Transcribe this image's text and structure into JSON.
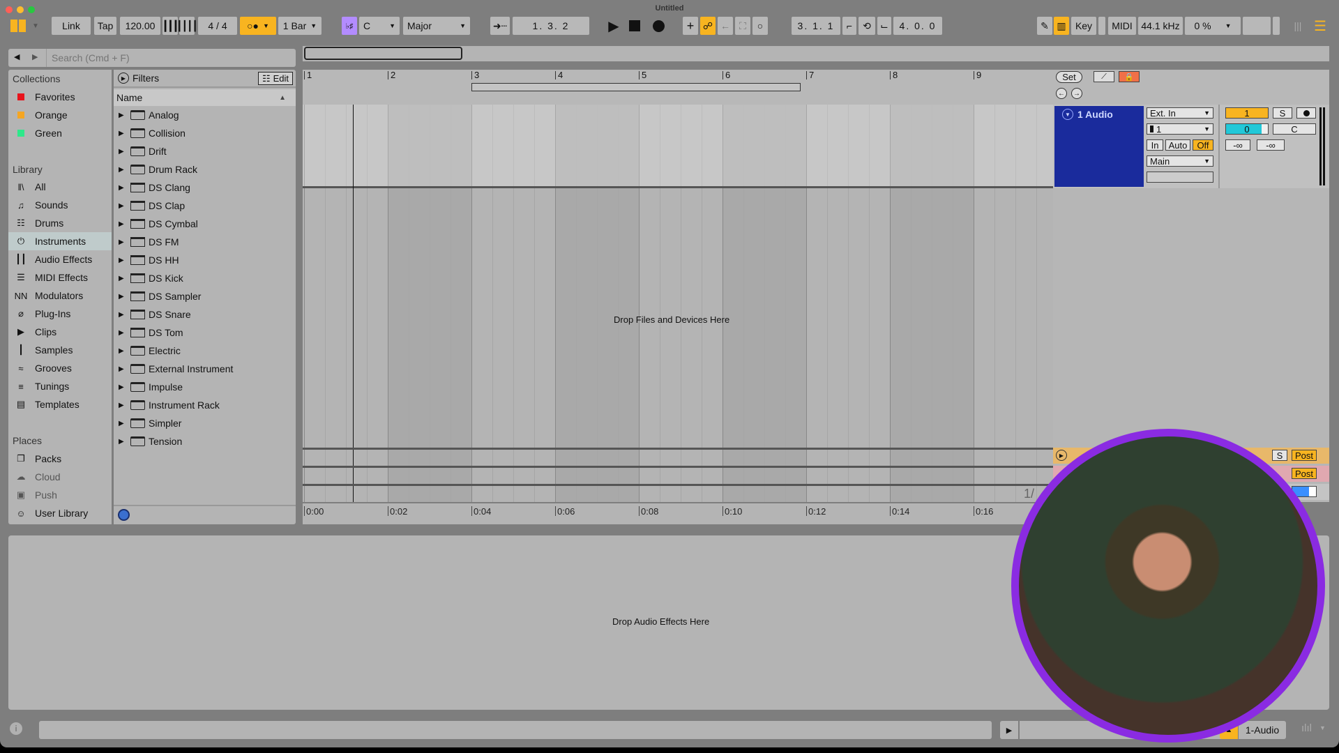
{
  "window": {
    "title": "Untitled"
  },
  "toolbar": {
    "link": "Link",
    "tap": "Tap",
    "tempo": "120.00",
    "time_signature": "4 / 4",
    "metronome_icon": "metronome-icon",
    "quantize": "1 Bar",
    "scale_root": "C",
    "scale_mode": "Major",
    "arrangement_position": "1.  3.  2",
    "loop_start": "3.  1.  1",
    "loop_length": "4.  0.  0",
    "key": "Key",
    "midi": "MIDI",
    "sample_rate": "44.1 kHz",
    "cpu": "0 %"
  },
  "browser": {
    "search_placeholder": "Search (Cmd + F)",
    "collections_title": "Collections",
    "collections": [
      {
        "label": "Favorites",
        "color": "#e8141c"
      },
      {
        "label": "Orange",
        "color": "#f5a623"
      },
      {
        "label": "Green",
        "color": "#2ee88a"
      }
    ],
    "library_title": "Library",
    "library": [
      {
        "label": "All",
        "icon": "all-icon",
        "glyph": "‖\\"
      },
      {
        "label": "Sounds",
        "icon": "sounds-icon",
        "glyph": "♫"
      },
      {
        "label": "Drums",
        "icon": "drums-icon",
        "glyph": "☷"
      },
      {
        "label": "Instruments",
        "icon": "instruments-icon",
        "glyph": "⏻",
        "selected": true
      },
      {
        "label": "Audio Effects",
        "icon": "audio-effects-icon",
        "glyph": "┃┃"
      },
      {
        "label": "MIDI Effects",
        "icon": "midi-effects-icon",
        "glyph": "☰"
      },
      {
        "label": "Modulators",
        "icon": "modulators-icon",
        "glyph": "NN"
      },
      {
        "label": "Plug-Ins",
        "icon": "plugins-icon",
        "glyph": "⌀"
      },
      {
        "label": "Clips",
        "icon": "clips-icon",
        "glyph": "▶"
      },
      {
        "label": "Samples",
        "icon": "samples-icon",
        "glyph": "┃"
      },
      {
        "label": "Grooves",
        "icon": "grooves-icon",
        "glyph": "≈"
      },
      {
        "label": "Tunings",
        "icon": "tunings-icon",
        "glyph": "≡"
      },
      {
        "label": "Templates",
        "icon": "templates-icon",
        "glyph": "▤"
      }
    ],
    "places_title": "Places",
    "places": [
      {
        "label": "Packs",
        "icon": "packs-icon",
        "glyph": "❐"
      },
      {
        "label": "Cloud",
        "icon": "cloud-icon",
        "glyph": "☁"
      },
      {
        "label": "Push",
        "icon": "push-icon",
        "glyph": "▣"
      },
      {
        "label": "User Library",
        "icon": "user-library-icon",
        "glyph": "☺"
      }
    ],
    "filters_label": "Filters",
    "edit_label": "Edit",
    "column_name": "Name",
    "items": [
      {
        "label": "Analog",
        "ds": false
      },
      {
        "label": "Collision",
        "ds": false
      },
      {
        "label": "Drift",
        "ds": false
      },
      {
        "label": "Drum Rack",
        "ds": false
      },
      {
        "label": "DS Clang",
        "ds": true
      },
      {
        "label": "DS Clap",
        "ds": true
      },
      {
        "label": "DS Cymbal",
        "ds": true
      },
      {
        "label": "DS FM",
        "ds": true
      },
      {
        "label": "DS HH",
        "ds": true
      },
      {
        "label": "DS Kick",
        "ds": true
      },
      {
        "label": "DS Sampler",
        "ds": true
      },
      {
        "label": "DS Snare",
        "ds": true
      },
      {
        "label": "DS Tom",
        "ds": true
      },
      {
        "label": "Electric",
        "ds": false
      },
      {
        "label": "External Instrument",
        "ds": false
      },
      {
        "label": "Impulse",
        "ds": false
      },
      {
        "label": "Instrument Rack",
        "ds": false
      },
      {
        "label": "Simpler",
        "ds": false
      },
      {
        "label": "Tension",
        "ds": false
      }
    ]
  },
  "arrangement": {
    "bars": [
      "1",
      "2",
      "3",
      "4",
      "5",
      "6",
      "7",
      "8",
      "9"
    ],
    "time_ticks": [
      "0:00",
      "0:02",
      "0:04",
      "0:06",
      "0:08",
      "0:10",
      "0:12",
      "0:14",
      "0:16"
    ],
    "drop_files_text": "Drop Files and Devices Here",
    "partial_label": "1/",
    "set_label": "Set"
  },
  "track": {
    "name": "1 Audio",
    "input_type": "Ext. In",
    "input_channel": "1",
    "monitor_in": "In",
    "monitor_auto": "Auto",
    "monitor_off": "Off",
    "output": "Main",
    "track_number": "1",
    "solo": "S",
    "volume": "0",
    "pan": "C",
    "send_a": "-∞",
    "send_b": "-∞",
    "return_post_a": "Post",
    "return_post_b": "Post",
    "return_solo": "S",
    "accent_color": "#1a2b9c"
  },
  "detail": {
    "drop_effects_text": "Drop Audio Effects Here"
  },
  "status": {
    "selected_track": "1-Audio"
  }
}
